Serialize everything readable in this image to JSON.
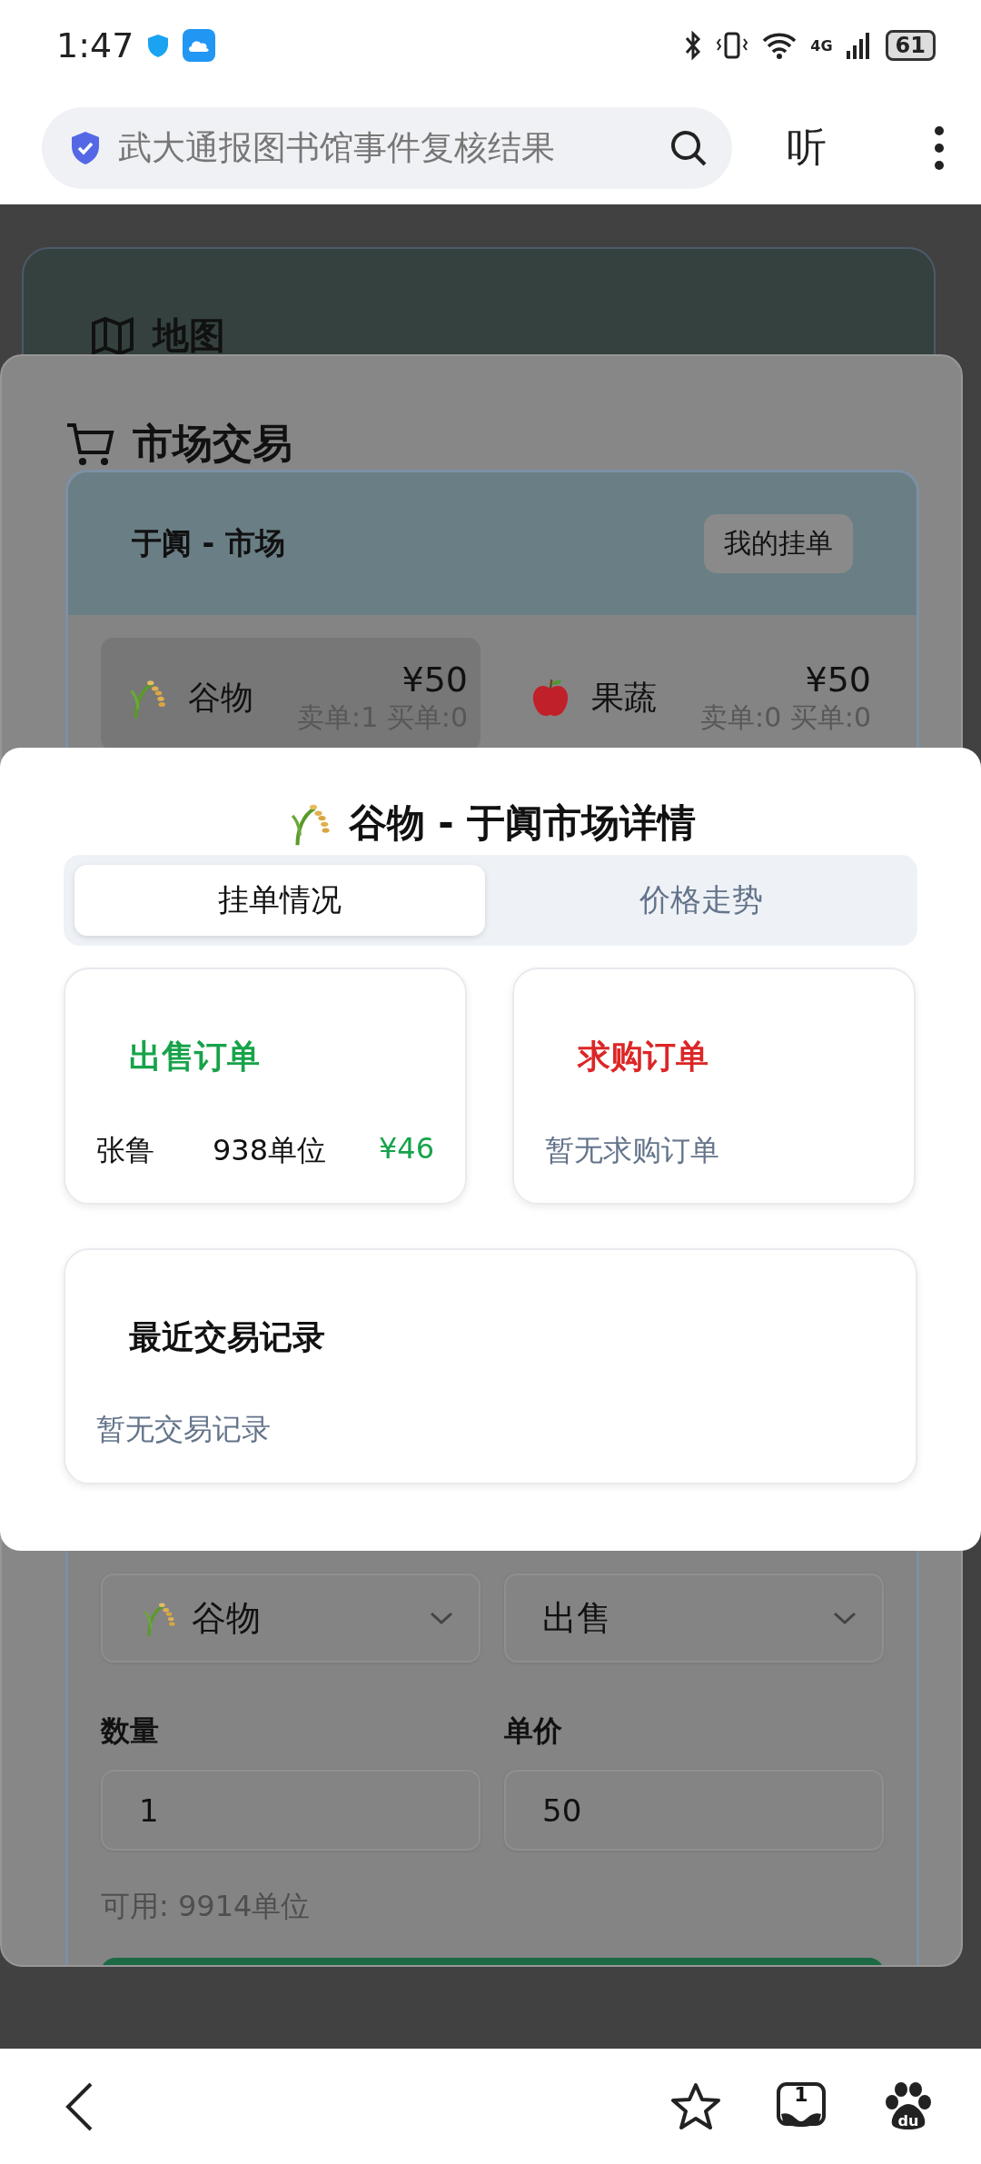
{
  "status_bar": {
    "time": "1:47",
    "network": "4G",
    "battery": "61"
  },
  "browser_bar": {
    "query": "武大通报图书馆事件复核结果",
    "listen_label": "听"
  },
  "background_card": {
    "title": "地图"
  },
  "market_panel": {
    "title": "市场交易",
    "market": {
      "title": "于阗 - 市场",
      "my_orders_button": "我的挂单",
      "goods": [
        {
          "name": "谷物",
          "price": "¥50",
          "counts": "卖单:1 买单:0",
          "selected": true,
          "kind": "grain"
        },
        {
          "name": "果蔬",
          "price": "¥50",
          "counts": "卖单:0 买单:0",
          "selected": false,
          "kind": "apple"
        }
      ]
    },
    "trade_form": {
      "goods_select": {
        "value": "谷物"
      },
      "side_select": {
        "value": "出售"
      },
      "fields": [
        {
          "label": "数量",
          "value": "1"
        },
        {
          "label": "单价",
          "value": "50"
        }
      ],
      "available": "可用: 9914单位"
    }
  },
  "dialog": {
    "title": "谷物 - 于阗市场详情",
    "tabs": [
      {
        "label": "挂单情况",
        "selected": true
      },
      {
        "label": "价格走势",
        "selected": false
      }
    ],
    "sell_orders": {
      "title": "出售订单",
      "rows": [
        {
          "name": "张鲁",
          "quantity": "938单位",
          "price": "¥46"
        }
      ]
    },
    "buy_orders": {
      "title": "求购订单",
      "empty_text": "暂无求购订单"
    },
    "recent_trades": {
      "title": "最近交易记录",
      "empty_text": "暂无交易记录"
    }
  },
  "bottom_nav": {
    "tab_count": "1",
    "logo_text": "du"
  }
}
